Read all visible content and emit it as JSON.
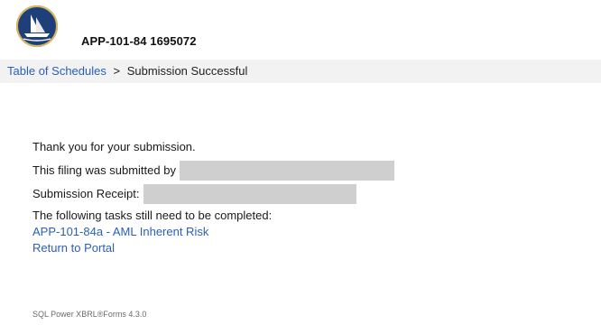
{
  "header": {
    "logo_icon": "sailing-ship-seal-icon",
    "app_title": "APP-101-84 1695072"
  },
  "breadcrumb": {
    "link_label": "Table of Schedules",
    "separator": ">",
    "current": "Submission Successful"
  },
  "main": {
    "thank_you": "Thank you for your submission.",
    "submitted_by_label": "This filing was submitted by",
    "receipt_label": "Submission Receipt:",
    "tasks_label": "The following tasks still need to be completed:",
    "task_link": "APP-101-84a - AML Inherent Risk",
    "portal_link": "Return to Portal"
  },
  "footer": {
    "version_text": "SQL Power XBRL®Forms 4.3.0"
  },
  "colors": {
    "link": "#2a5fb8",
    "breadcrumb_bg": "#f2f2f2",
    "redaction": "#cfcfcf",
    "logo_navy": "#1f3f7a",
    "logo_gold": "#d9b75a"
  }
}
